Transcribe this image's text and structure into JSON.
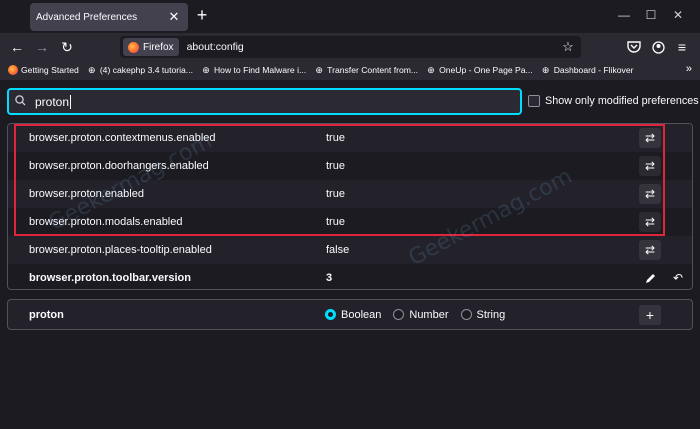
{
  "tab": {
    "title": "Advanced Preferences"
  },
  "window_controls": [
    "—",
    "☐",
    "✕"
  ],
  "navbar": {
    "identity_label": "Firefox",
    "url": "about:config"
  },
  "bookmarks": [
    {
      "label": "Getting Started",
      "icon": "firefox-icon"
    },
    {
      "label": "(4) cakephp 3.4 tutoria...",
      "icon": "globe-icon"
    },
    {
      "label": "How to Find Malware i...",
      "icon": "globe-icon"
    },
    {
      "label": "Transfer Content from...",
      "icon": "globe-icon"
    },
    {
      "label": "OneUp - One Page Pa...",
      "icon": "globe-icon"
    },
    {
      "label": "Dashboard - Flikover",
      "icon": "globe-icon"
    }
  ],
  "search": {
    "value": "proton"
  },
  "show_modified_label": "Show only modified preferences",
  "preferences": [
    {
      "name": "browser.proton.contextmenus.enabled",
      "value": "true",
      "modified": false
    },
    {
      "name": "browser.proton.doorhangers.enabled",
      "value": "true",
      "modified": false
    },
    {
      "name": "browser.proton.enabled",
      "value": "true",
      "modified": false
    },
    {
      "name": "browser.proton.modals.enabled",
      "value": "true",
      "modified": false
    },
    {
      "name": "browser.proton.places-tooltip.enabled",
      "value": "false",
      "modified": false
    },
    {
      "name": "browser.proton.toolbar.version",
      "value": "3",
      "modified": true
    }
  ],
  "add_row": {
    "name": "proton",
    "types": [
      "Boolean",
      "Number",
      "String"
    ],
    "selected_type": "Boolean"
  },
  "watermark_text": "Geekermag.com",
  "colors": {
    "accent": "#00ddff",
    "highlight": "#e0243a"
  }
}
